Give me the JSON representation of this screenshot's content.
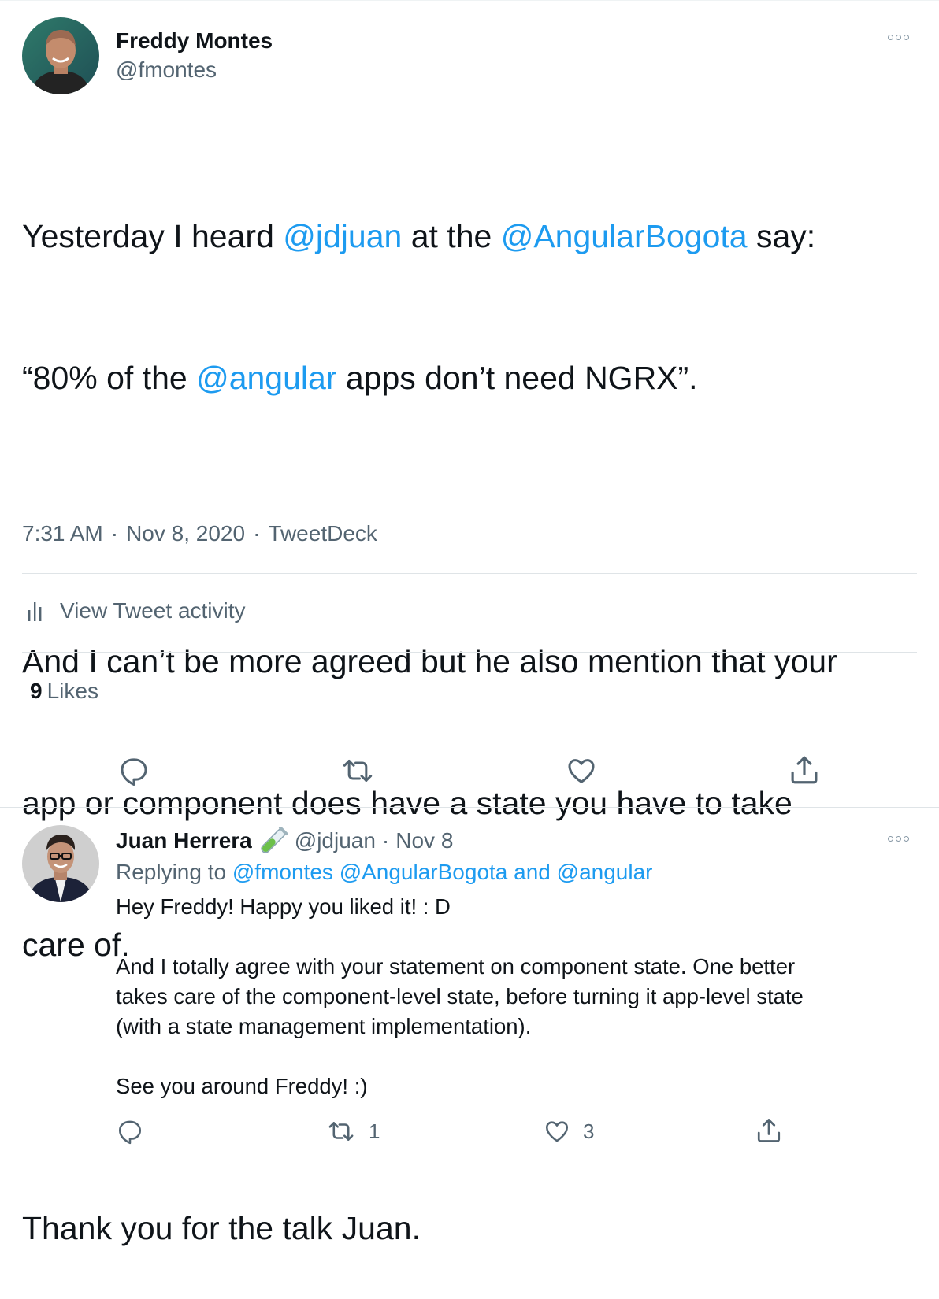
{
  "main_tweet": {
    "author_name": "Freddy Montes",
    "author_handle": "@fmontes",
    "text": {
      "l1_a": "Yesterday I heard ",
      "l1_mention1": "@jdjuan",
      "l1_b": " at the ",
      "l1_mention2": "@AngularBogota",
      "l1_c": " say:",
      "l2_a": "“80% of the ",
      "l2_mention": "@angular",
      "l2_b": " apps don’t need NGRX”.",
      "p2_l1": "And I can’t be more agreed but he also mention that your",
      "p2_l2": "app or component does have a state you have to take",
      "p2_l3": "care of.",
      "p3": "Thank you for the talk Juan."
    },
    "time": "7:31 AM",
    "date": "Nov 8, 2020",
    "source": "TweetDeck",
    "separator": "·",
    "activity_label": "View Tweet activity",
    "likes_count": "9",
    "likes_label": "Likes"
  },
  "reply": {
    "author_name": "Juan Herrera",
    "author_handle": "@jdjuan",
    "separator": "·",
    "date": "Nov 8",
    "replying_prefix": "Replying to",
    "replying_to_1": "@fmontes",
    "replying_to_2": "@AngularBogota",
    "replying_and": "and",
    "replying_to_3": "@angular",
    "text": {
      "l1": "Hey Freddy! Happy you liked it! : D",
      "l2": "And I totally agree with your statement on component state. One better",
      "l3": "takes care of the component-level state, before turning it app-level state",
      "l4": "(with a state management implementation).",
      "l5": "See you around Freddy! :)"
    },
    "retweet_count": "1",
    "like_count": "3"
  },
  "icons": {
    "reply": "reply-icon",
    "retweet": "retweet-icon",
    "like": "heart-icon",
    "share": "share-icon",
    "more": "more-icon",
    "activity": "bar-chart-icon",
    "emoji": "test-tube-emoji"
  },
  "colors": {
    "mention": "#1d9bf0",
    "secondary_text": "#536471",
    "primary_text": "#0f1419",
    "divider": "#dfe4e7"
  }
}
